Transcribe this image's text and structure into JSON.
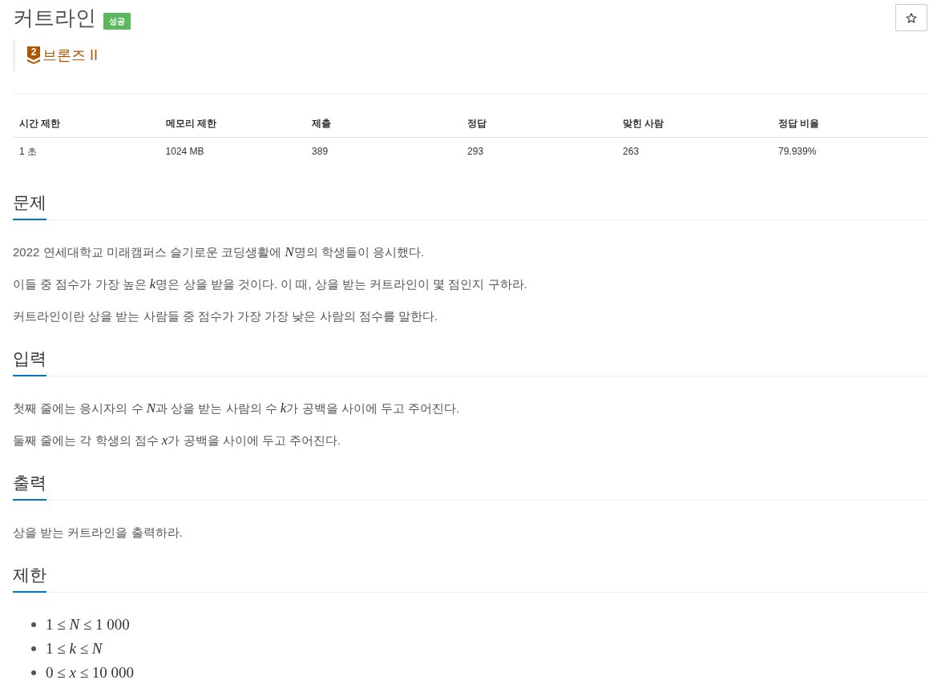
{
  "title": "커트라인",
  "result_badge": "성공",
  "favorite_button": {
    "starred": false
  },
  "tier": {
    "badge": "2",
    "name": "브론즈 II"
  },
  "info_table": {
    "columns": [
      "시간 제한",
      "메모리 제한",
      "제출",
      "정답",
      "맞힌 사람",
      "정답 비율"
    ],
    "rows": [
      [
        "1 초",
        "1024 MB",
        "389",
        "293",
        "263",
        "79.939%"
      ]
    ]
  },
  "sections": [
    {
      "heading": "문제",
      "kind": "text",
      "paragraphs": [
        [
          {
            "kind": "text",
            "text": "2022 연세대학교 미래캠퍼스 슬기로운 코딩생활에 "
          },
          {
            "kind": "var",
            "text": "N"
          },
          {
            "kind": "text",
            "text": "명의 학생들이 응시했다."
          }
        ],
        [
          {
            "kind": "text",
            "text": "이들 중 점수가 가장 높은 "
          },
          {
            "kind": "var",
            "text": "k"
          },
          {
            "kind": "text",
            "text": "명은 상을 받을 것이다. 이 때, 상을 받는 커트라인이 몇 점인지 구하라."
          }
        ],
        [
          {
            "kind": "text",
            "text": "커트라인이란 상을 받는 사람들 중 점수가 가장 가장 낮은 사람의 점수를 말한다."
          }
        ]
      ]
    },
    {
      "heading": "입력",
      "kind": "text",
      "paragraphs": [
        [
          {
            "kind": "text",
            "text": "첫째 줄에는 응시자의 수 "
          },
          {
            "kind": "var",
            "text": "N"
          },
          {
            "kind": "text",
            "text": "과 상을 받는 사람의 수 "
          },
          {
            "kind": "var",
            "text": "k"
          },
          {
            "kind": "text",
            "text": "가 공백을 사이에 두고 주어진다."
          }
        ],
        [
          {
            "kind": "text",
            "text": "둘째 줄에는 각 학생의 점수 "
          },
          {
            "kind": "var",
            "text": "x"
          },
          {
            "kind": "text",
            "text": "가 공백을 사이에 두고 주어진다."
          }
        ]
      ]
    },
    {
      "heading": "출력",
      "kind": "text",
      "paragraphs": [
        [
          {
            "kind": "text",
            "text": "상을 받는 커트라인을 출력하라."
          }
        ]
      ]
    },
    {
      "heading": "제한",
      "kind": "list",
      "items": [
        "1 ≤ *N* ≤ 1 000",
        "1 ≤ *k* ≤ *N*",
        "0 ≤ *x* ≤ 10 000"
      ]
    }
  ]
}
